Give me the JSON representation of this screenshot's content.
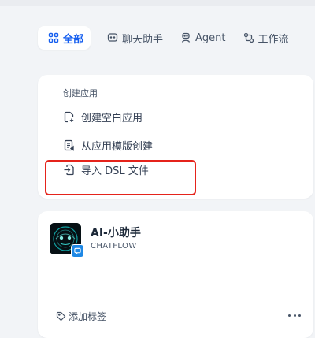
{
  "tabs": [
    {
      "label": "全部",
      "icon": "grid-icon",
      "active": true
    },
    {
      "label": "聊天助手",
      "icon": "chat-icon",
      "active": false
    },
    {
      "label": "Agent",
      "icon": "agent-icon",
      "active": false
    },
    {
      "label": "工作流",
      "icon": "workflow-icon",
      "active": false
    }
  ],
  "create": {
    "title": "创建应用",
    "items": [
      {
        "label": "创建空白应用",
        "icon": "file-plus-icon"
      },
      {
        "label": "从应用模版创建",
        "icon": "template-icon"
      },
      {
        "label": "导入 DSL 文件",
        "icon": "file-import-icon"
      }
    ],
    "highlight_color": "#e5231b"
  },
  "app": {
    "name": "AI-小助手",
    "type": "CHATFLOW",
    "tag_label": "添加标签",
    "badge_color": "#1e88e5"
  },
  "colors": {
    "accent": "#155eef",
    "background": "#f2f4f7",
    "card": "#ffffff"
  }
}
